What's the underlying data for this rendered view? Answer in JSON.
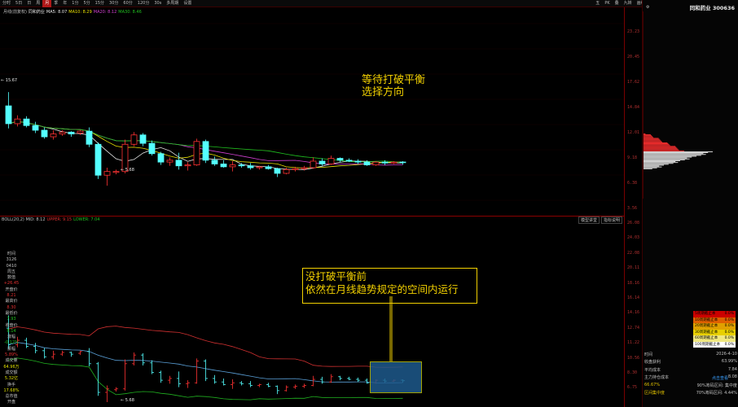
{
  "toolbar": {
    "items": [
      {
        "label": "分时"
      },
      {
        "label": "5日"
      },
      {
        "label": "日"
      },
      {
        "label": "周"
      },
      {
        "label": "月",
        "active": true
      },
      {
        "label": "季"
      },
      {
        "label": "年"
      },
      {
        "label": "1分"
      },
      {
        "label": "5分"
      },
      {
        "label": "15分"
      },
      {
        "label": "30分"
      },
      {
        "label": "60分"
      },
      {
        "label": "120分"
      },
      {
        "label": "30s"
      },
      {
        "label": "多周期"
      },
      {
        "label": "设置"
      }
    ],
    "right_items": [
      {
        "label": "五"
      },
      {
        "label": "PK"
      },
      {
        "label": "叠"
      },
      {
        "label": "九转"
      },
      {
        "label": "画线"
      },
      {
        "label": "翻面"
      },
      {
        "label": "随缘"
      },
      {
        "label": "标记"
      },
      {
        "label": "技术"
      },
      {
        "label": "券商"
      },
      {
        "label": "操盘"
      },
      {
        "label": "F10"
      }
    ]
  },
  "main": {
    "title": "月线(前复权)",
    "stock_label": "同和药业",
    "ma": [
      {
        "label": "MA5: 8.07",
        "color": "#e8e8e8"
      },
      {
        "label": "MA10: 8.29",
        "color": "#e8e000"
      },
      {
        "label": "MA20: 8.12",
        "color": "#d040d0"
      },
      {
        "label": "MA30: 8.46",
        "color": "#20c020"
      }
    ],
    "price_high": "15.67",
    "price_low": "5.68",
    "axis_labels": [
      "23.23",
      "20.45",
      "17.62",
      "14.84",
      "12.01",
      "9.18",
      "6.38",
      "3.56"
    ],
    "annotation": [
      "等待打破平衡",
      "选择方向"
    ]
  },
  "indicator": {
    "title": "BOLL(20,2) MID: 8.12",
    "upper": "UPPER: 9.15",
    "lower": "LOWER: 7.04",
    "tabs": [
      "模型讲堂",
      "指标说明"
    ],
    "axis_labels": [
      "26.08",
      "24.03",
      "22.08",
      "20.11",
      "18.16",
      "16.14",
      "14.16",
      "12.74",
      "11.22",
      "10.56",
      "8.30",
      "6.75"
    ],
    "annotation": [
      "没打破平衡前",
      "依然在月线趋势规定的空间内运行"
    ],
    "low_label": "5.68"
  },
  "left_info": [
    {
      "label": "时间",
      "color": "#c0c0c0"
    },
    {
      "label": "3126",
      "color": "#c0c0c0"
    },
    {
      "label": "0410",
      "color": "#c0c0c0"
    },
    {
      "label": "周五",
      "color": "#c0c0c0"
    },
    {
      "label": "数值",
      "color": "#c0c0c0"
    },
    {
      "label": "+26.45",
      "color": "#e03030"
    },
    {
      "label": "开盘价",
      "color": "#c0c0c0"
    },
    {
      "label": "8.21",
      "color": "#e03030"
    },
    {
      "label": "最高价",
      "color": "#c0c0c0"
    },
    {
      "label": "8.30",
      "color": "#e03030"
    },
    {
      "label": "最低价",
      "color": "#c0c0c0"
    },
    {
      "label": "7.93",
      "color": "#20c020"
    },
    {
      "label": "收盘价",
      "color": "#c0c0c0"
    },
    {
      "label": "8.14",
      "color": "#20c020"
    },
    {
      "label": "涨幅",
      "color": "#c0c0c0"
    },
    {
      "label": "-0.12%",
      "color": "#20c020"
    },
    {
      "label": "振幅",
      "color": "#c0c0c0"
    },
    {
      "label": "5.89%",
      "color": "#e03030"
    },
    {
      "label": "成交量",
      "color": "#c0c0c0"
    },
    {
      "label": "64.96万",
      "color": "#e0e000"
    },
    {
      "label": "成交额",
      "color": "#c0c0c0"
    },
    {
      "label": "5.32亿",
      "color": "#e0e000"
    },
    {
      "label": "换手",
      "color": "#c0c0c0"
    },
    {
      "label": "17.68%",
      "color": "#e0e000"
    },
    {
      "label": "总市值",
      "color": "#c0c0c0"
    },
    {
      "label": "开盘",
      "color": "#c0c0c0"
    }
  ],
  "side": {
    "title": "同和药业 300636",
    "axis_labels": [
      "23.23",
      "20.45",
      "17.62",
      "14.84",
      "12.01",
      "9.18",
      "6.38",
      "3.56"
    ],
    "cost_table": [
      {
        "label": "5周期截止本",
        "value": "0.0%",
        "bg": "#cc0000"
      },
      {
        "label": "10周期截止本",
        "value": "0.0%",
        "bg": "#e06000"
      },
      {
        "label": "20周期截止本",
        "value": "0.0%",
        "bg": "#e0a000"
      },
      {
        "label": "30周期截止本",
        "value": "0.0%",
        "bg": "#e8d000"
      },
      {
        "label": "60周期截止本",
        "value": "0.0%",
        "bg": "#f0e880"
      },
      {
        "label": "100周期截止本",
        "value": "0.0%",
        "bg": "#ffffff"
      }
    ],
    "info": [
      {
        "label": "时间",
        "value": "2026-4-10"
      },
      {
        "label": "收盘获利",
        "value": "63.99%"
      },
      {
        "label": "平均成本",
        "value": "7.84"
      },
      {
        "label": "主力持仓成本",
        "value": "8.08"
      },
      {
        "label": "66.67%",
        "value": "90%筹码区间: 集中度"
      },
      {
        "label": "区间集中度",
        "value": "70%筹码区间: 4.44%"
      }
    ],
    "change_label": "点击查看"
  },
  "chart_data": {
    "type": "candlestick",
    "series_candles": [
      {
        "o": 14.2,
        "h": 15.67,
        "l": 11.8,
        "c": 12.3
      },
      {
        "o": 12.3,
        "h": 13.2,
        "l": 12.0,
        "c": 12.8
      },
      {
        "o": 12.8,
        "h": 13.1,
        "l": 11.9,
        "c": 12.1
      },
      {
        "o": 12.1,
        "h": 12.5,
        "l": 11.3,
        "c": 11.6
      },
      {
        "o": 11.6,
        "h": 11.9,
        "l": 10.7,
        "c": 10.9
      },
      {
        "o": 10.9,
        "h": 11.6,
        "l": 10.6,
        "c": 11.2
      },
      {
        "o": 11.2,
        "h": 11.6,
        "l": 11.0,
        "c": 11.4
      },
      {
        "o": 11.4,
        "h": 11.5,
        "l": 10.9,
        "c": 11.2
      },
      {
        "o": 11.3,
        "h": 11.6,
        "l": 11.1,
        "c": 11.5
      },
      {
        "o": 11.5,
        "h": 11.9,
        "l": 9.8,
        "c": 10.1
      },
      {
        "o": 10.1,
        "h": 10.3,
        "l": 6.4,
        "c": 6.8
      },
      {
        "o": 6.8,
        "h": 7.6,
        "l": 5.68,
        "c": 7.2
      },
      {
        "o": 7.1,
        "h": 7.4,
        "l": 6.9,
        "c": 7.2
      },
      {
        "o": 7.2,
        "h": 10.6,
        "l": 7.0,
        "c": 10.1
      },
      {
        "o": 10.1,
        "h": 11.4,
        "l": 9.9,
        "c": 11.1
      },
      {
        "o": 11.1,
        "h": 11.3,
        "l": 9.9,
        "c": 10.2
      },
      {
        "o": 10.2,
        "h": 10.5,
        "l": 8.9,
        "c": 9.1
      },
      {
        "o": 9.1,
        "h": 9.3,
        "l": 7.9,
        "c": 8.2
      },
      {
        "o": 8.2,
        "h": 8.7,
        "l": 7.8,
        "c": 8.4
      },
      {
        "o": 8.4,
        "h": 9.2,
        "l": 7.4,
        "c": 7.8
      },
      {
        "o": 7.8,
        "h": 8.2,
        "l": 7.3,
        "c": 7.9
      },
      {
        "o": 7.9,
        "h": 10.7,
        "l": 7.8,
        "c": 10.4
      },
      {
        "o": 10.4,
        "h": 10.6,
        "l": 8.1,
        "c": 8.4
      },
      {
        "o": 8.4,
        "h": 8.8,
        "l": 7.8,
        "c": 8.0
      },
      {
        "o": 8.0,
        "h": 8.4,
        "l": 7.6,
        "c": 7.7
      },
      {
        "o": 7.7,
        "h": 8.3,
        "l": 7.2,
        "c": 7.9
      },
      {
        "o": 7.9,
        "h": 8.1,
        "l": 7.6,
        "c": 7.8
      },
      {
        "o": 7.8,
        "h": 8.1,
        "l": 7.4,
        "c": 7.6
      },
      {
        "o": 7.6,
        "h": 7.8,
        "l": 7.4,
        "c": 7.7
      },
      {
        "o": 7.7,
        "h": 7.9,
        "l": 7.4,
        "c": 7.5
      },
      {
        "o": 7.5,
        "h": 7.6,
        "l": 6.6,
        "c": 7.0
      },
      {
        "o": 7.0,
        "h": 7.6,
        "l": 6.9,
        "c": 7.4
      },
      {
        "o": 7.4,
        "h": 7.7,
        "l": 7.2,
        "c": 7.5
      },
      {
        "o": 7.5,
        "h": 7.8,
        "l": 7.3,
        "c": 7.6
      },
      {
        "o": 7.6,
        "h": 8.7,
        "l": 7.5,
        "c": 8.3
      },
      {
        "o": 8.3,
        "h": 8.6,
        "l": 7.8,
        "c": 8.0
      },
      {
        "o": 8.0,
        "h": 8.9,
        "l": 7.9,
        "c": 8.6
      },
      {
        "o": 8.6,
        "h": 8.7,
        "l": 8.2,
        "c": 8.4
      },
      {
        "o": 8.4,
        "h": 8.6,
        "l": 8.2,
        "c": 8.3
      },
      {
        "o": 8.3,
        "h": 8.5,
        "l": 8.0,
        "c": 8.2
      },
      {
        "o": 8.2,
        "h": 8.4,
        "l": 7.8,
        "c": 7.9
      },
      {
        "o": 7.9,
        "h": 8.3,
        "l": 7.8,
        "c": 8.2
      },
      {
        "o": 8.2,
        "h": 8.4,
        "l": 7.9,
        "c": 8.1
      },
      {
        "o": 8.1,
        "h": 8.3,
        "l": 8.0,
        "c": 8.2
      },
      {
        "o": 8.21,
        "h": 8.3,
        "l": 7.93,
        "c": 8.14
      }
    ],
    "price_range": [
      3.0,
      23.5
    ],
    "boll_range": [
      5.3,
      26.5
    ],
    "ma_colors": [
      "#e8e8e8",
      "#e8e000",
      "#d040d0",
      "#20c020"
    ],
    "boll_colors": {
      "upper": "#d03030",
      "mid": "#5aa0d8",
      "lower": "#20b020"
    }
  }
}
